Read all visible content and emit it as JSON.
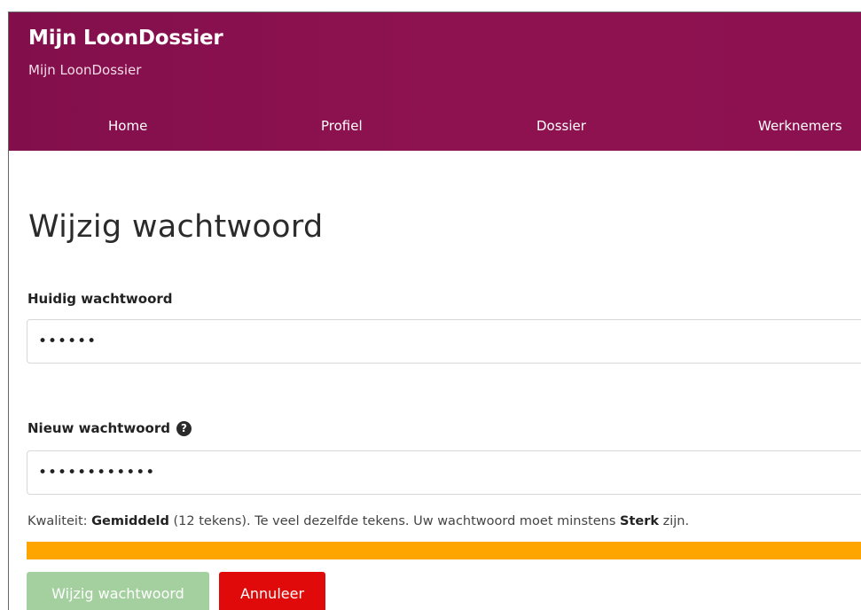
{
  "header": {
    "title": "Mijn LoonDossier",
    "subtitle": "Mijn LoonDossier",
    "background": "#8c1150"
  },
  "nav": {
    "items": [
      {
        "label": "Home"
      },
      {
        "label": "Profiel"
      },
      {
        "label": "Dossier"
      },
      {
        "label": "Werknemers"
      }
    ]
  },
  "page": {
    "title": "Wijzig wachtwoord"
  },
  "form": {
    "current_password": {
      "label": "Huidig wachtwoord",
      "value": "••••••"
    },
    "new_password": {
      "label": "Nieuw wachtwoord",
      "help_icon": "question-circle-icon",
      "value": "••••••••••••"
    },
    "quality": {
      "prefix": "Kwaliteit: ",
      "level": "Gemiddeld",
      "detail": " (12 tekens). Te veel dezelfde tekens. Uw wachtwoord moet minstens ",
      "required_level": "Sterk",
      "suffix": " zijn.",
      "bar_fill": 1.0,
      "bar_color": "#ffa500"
    },
    "buttons": {
      "submit": "Wijzig wachtwoord",
      "cancel": "Annuleer"
    }
  }
}
